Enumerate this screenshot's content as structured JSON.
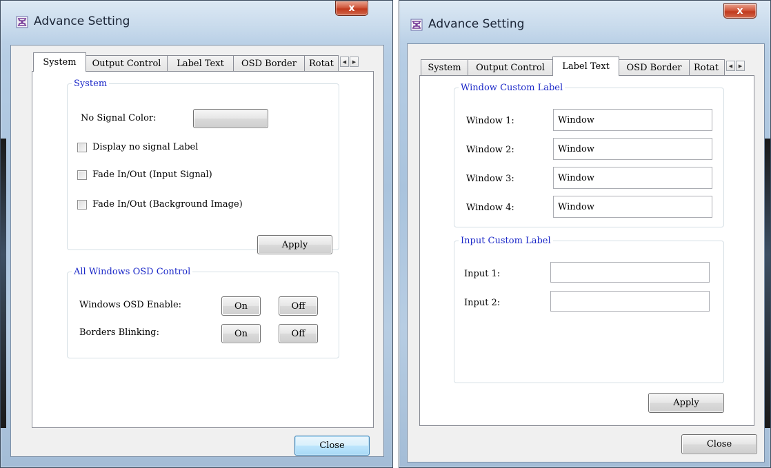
{
  "windows": [
    {
      "title": "Advance Setting",
      "close_glyph": "x",
      "app_icon": "app-icon",
      "tabs": [
        "System",
        "Output Control",
        "Label Text",
        "OSD Border",
        "Rotat"
      ],
      "active_tab": "System",
      "scroll_left_glyph": "◀",
      "scroll_right_glyph": "▶",
      "system_group": {
        "legend": "System",
        "no_signal_color_label": "No Signal Color:",
        "checkboxes": [
          {
            "label": "Display no signal Label",
            "checked": false
          },
          {
            "label": "Fade In/Out (Input Signal)",
            "checked": false
          },
          {
            "label": "Fade In/Out (Background Image)",
            "checked": false
          }
        ],
        "apply_label": "Apply"
      },
      "osd_group": {
        "legend": "All Windows OSD Control",
        "rows": [
          {
            "label": "Windows OSD Enable:",
            "on": "On",
            "off": "Off"
          },
          {
            "label": "Borders Blinking:",
            "on": "On",
            "off": "Off"
          }
        ]
      },
      "close_label": "Close"
    },
    {
      "title": "Advance Setting",
      "close_glyph": "x",
      "app_icon": "app-icon",
      "tabs": [
        "System",
        "Output Control",
        "Label Text",
        "OSD Border",
        "Rotat"
      ],
      "active_tab": "Label Text",
      "scroll_left_glyph": "◀",
      "scroll_right_glyph": "▶",
      "window_group": {
        "legend": "Window Custom Label",
        "rows": [
          {
            "label": "Window 1:",
            "value": "Window"
          },
          {
            "label": "Window 2:",
            "value": "Window"
          },
          {
            "label": "Window 3:",
            "value": "Window"
          },
          {
            "label": "Window 4:",
            "value": "Window"
          }
        ]
      },
      "input_group": {
        "legend": "Input Custom Label",
        "rows": [
          {
            "label": "Input 1:",
            "value": ""
          },
          {
            "label": "Input 2:",
            "value": ""
          }
        ]
      },
      "apply_label": "Apply",
      "close_label": "Close"
    }
  ]
}
